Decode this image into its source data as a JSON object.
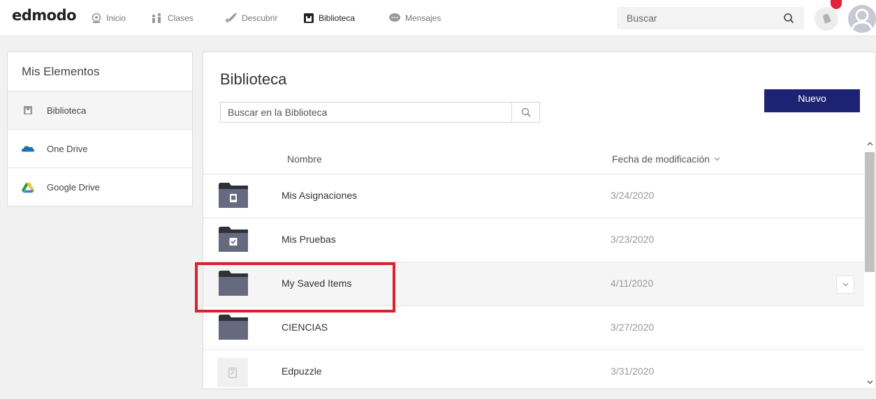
{
  "app": {
    "logo": "edmodo"
  },
  "nav": {
    "items": [
      {
        "label": "Inicio",
        "icon": "home-icon"
      },
      {
        "label": "Clases",
        "icon": "classes-icon"
      },
      {
        "label": "Descubrir",
        "icon": "rocket-icon"
      },
      {
        "label": "Biblioteca",
        "icon": "library-icon",
        "active": true
      },
      {
        "label": "Mensajes",
        "icon": "message-icon"
      }
    ],
    "search_placeholder": "Buscar"
  },
  "sidebar": {
    "title": "Mis Elementos",
    "items": [
      {
        "label": "Biblioteca",
        "icon": "library-icon",
        "active": true
      },
      {
        "label": "One Drive",
        "icon": "onedrive-icon"
      },
      {
        "label": "Google Drive",
        "icon": "google-drive-icon"
      }
    ]
  },
  "main": {
    "title": "Biblioteca",
    "search_placeholder": "Buscar en la Biblioteca",
    "new_button": "Nuevo",
    "columns": {
      "name": "Nombre",
      "modified": "Fecha de modificación"
    },
    "rows": [
      {
        "name": "Mis Asignaciones",
        "date": "3/24/2020",
        "icon": "assignment-folder-icon"
      },
      {
        "name": "Mis Pruebas",
        "date": "3/23/2020",
        "icon": "quiz-folder-icon"
      },
      {
        "name": "My Saved Items",
        "date": "4/11/2020",
        "icon": "folder-icon",
        "selected": true
      },
      {
        "name": "CIENCIAS",
        "date": "3/27/2020",
        "icon": "folder-icon"
      },
      {
        "name": "Edpuzzle",
        "date": "3/31/2020",
        "icon": "link-file-icon"
      }
    ]
  },
  "colors": {
    "primary_button": "#1d2272",
    "highlight_box": "#d8232a",
    "notification": "#e0233a"
  }
}
